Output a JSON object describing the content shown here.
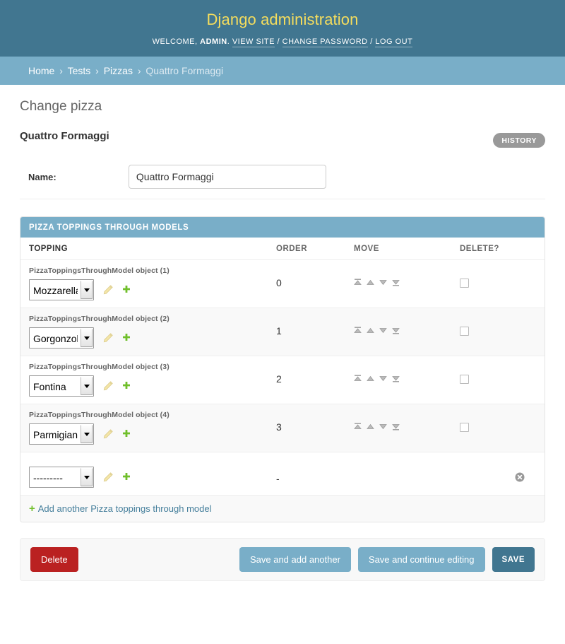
{
  "header": {
    "site_name": "Django administration",
    "welcome_prefix": "Welcome,",
    "username": "ADMIN",
    "period": ".",
    "links": [
      {
        "label": "VIEW SITE",
        "name": "view-site-link"
      },
      {
        "label": "CHANGE PASSWORD",
        "name": "change-password-link"
      },
      {
        "label": "LOG OUT",
        "name": "log-out-link"
      }
    ],
    "separator": "/"
  },
  "breadcrumbs": {
    "separator": "›",
    "items": [
      {
        "label": "Home",
        "current": false
      },
      {
        "label": "Tests",
        "current": false
      },
      {
        "label": "Pizzas",
        "current": false
      },
      {
        "label": "Quattro Formaggi",
        "current": true
      }
    ]
  },
  "content": {
    "page_title": "Change pizza",
    "object_name": "Quattro Formaggi",
    "history_button": "History"
  },
  "form": {
    "name_label": "Name:",
    "name_value": "Quattro Formaggi",
    "name_placeholder": ""
  },
  "inline": {
    "heading": "Pizza toppings through models",
    "columns": {
      "topping": "Topping",
      "order": "Order",
      "move": "Move",
      "delete": "Delete?"
    },
    "rows": [
      {
        "object_label": "PizzaToppingsThroughModel object (1)",
        "topping": "Mozzarella",
        "order": "0",
        "has_move": true,
        "has_delete_checkbox": true,
        "delete_checked": false
      },
      {
        "object_label": "PizzaToppingsThroughModel object (2)",
        "topping": "Gorgonzola",
        "order": "1",
        "has_move": true,
        "has_delete_checkbox": true,
        "delete_checked": false
      },
      {
        "object_label": "PizzaToppingsThroughModel object (3)",
        "topping": "Fontina",
        "order": "2",
        "has_move": true,
        "has_delete_checkbox": true,
        "delete_checked": false
      },
      {
        "object_label": "PizzaToppingsThroughModel object (4)",
        "topping": "Parmigiano",
        "order": "3",
        "has_move": true,
        "has_delete_checkbox": true,
        "delete_checked": false
      },
      {
        "object_label": "",
        "topping": "---------",
        "order": "-",
        "has_move": false,
        "has_delete_checkbox": false,
        "delete_checked": false
      }
    ],
    "add_another_label": "Add another Pizza toppings through model",
    "add_another_plus": "+",
    "icons": {
      "change_title": "edit-icon",
      "add_title": "add-icon",
      "move_to_top": "move-to-top-icon",
      "move_up": "move-up-icon",
      "move_down": "move-down-icon",
      "move_to_bottom": "move-to-bottom-icon",
      "remove": "remove-row-icon"
    }
  },
  "submit_row": {
    "delete_label": "Delete",
    "save_add_another_label": "Save and add another",
    "save_continue_label": "Save and continue editing",
    "save_label": "SAVE"
  },
  "colors": {
    "header_bg": "#417690",
    "header_title": "#f5dd5d",
    "breadcrumb_bg": "#79aec8",
    "inline_heading_bg": "#79aec8",
    "delete_button": "#ba2121",
    "save_button": "#417690",
    "secondary_button": "#79aec8",
    "history_button": "#999999",
    "add_icon": "#70bf2b",
    "link": "#447e9b"
  }
}
